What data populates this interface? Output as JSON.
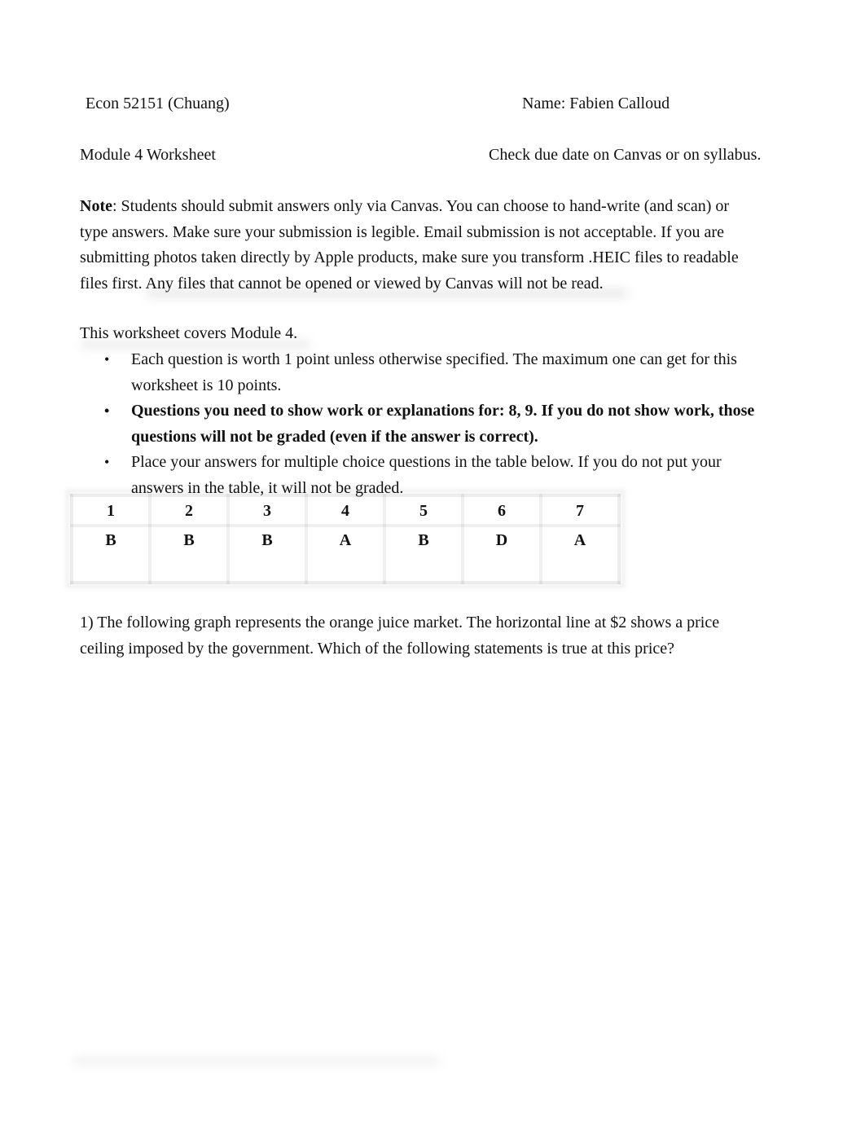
{
  "header": {
    "course": "Econ 52151 (Chuang)",
    "name_label": "Name: Fabien Calloud",
    "module_title": "Module 4 Worksheet",
    "due_note": "Check due date on Canvas or on syllabus."
  },
  "note": {
    "label": "Note",
    "lines": [
      ": Students should submit answers only via Canvas. You can choose to hand-write (and scan) or",
      "type answers. Make sure your submission is legible. Email submission is not acceptable. If you are",
      "submitting photos taken directly by Apple products, make sure you transform .HEIC files to readable",
      "files first. Any files that cannot be opened or viewed by Canvas will not be read."
    ]
  },
  "intro": {
    "covers": "This worksheet covers Module 4.",
    "bullets": [
      {
        "bold": false,
        "lines": [
          "Each question is worth 1 point unless otherwise specified. The maximum one can get for this",
          "worksheet is 10 points."
        ]
      },
      {
        "bold": true,
        "lines": [
          "Questions you need to show work or explanations for: 8, 9. If you do not show work, those",
          "questions will not be graded (even if the answer is correct)."
        ]
      },
      {
        "bold": false,
        "lines": [
          "Place your answers for multiple choice questions in the table below. If you do not put your",
          "answers in the table, it will not be graded."
        ]
      }
    ],
    "bullet_glyph": "•"
  },
  "answer_table": {
    "questions": [
      "1",
      "2",
      "3",
      "4",
      "5",
      "6",
      "7"
    ],
    "answers": [
      "B",
      "B",
      "B",
      "A",
      "B",
      "D",
      "A"
    ]
  },
  "question_1": {
    "lines": [
      "1) The following graph represents the orange juice market. The horizontal line at $2 shows a price",
      "ceiling imposed by the government. Which of the following statements is true at this price?"
    ]
  }
}
